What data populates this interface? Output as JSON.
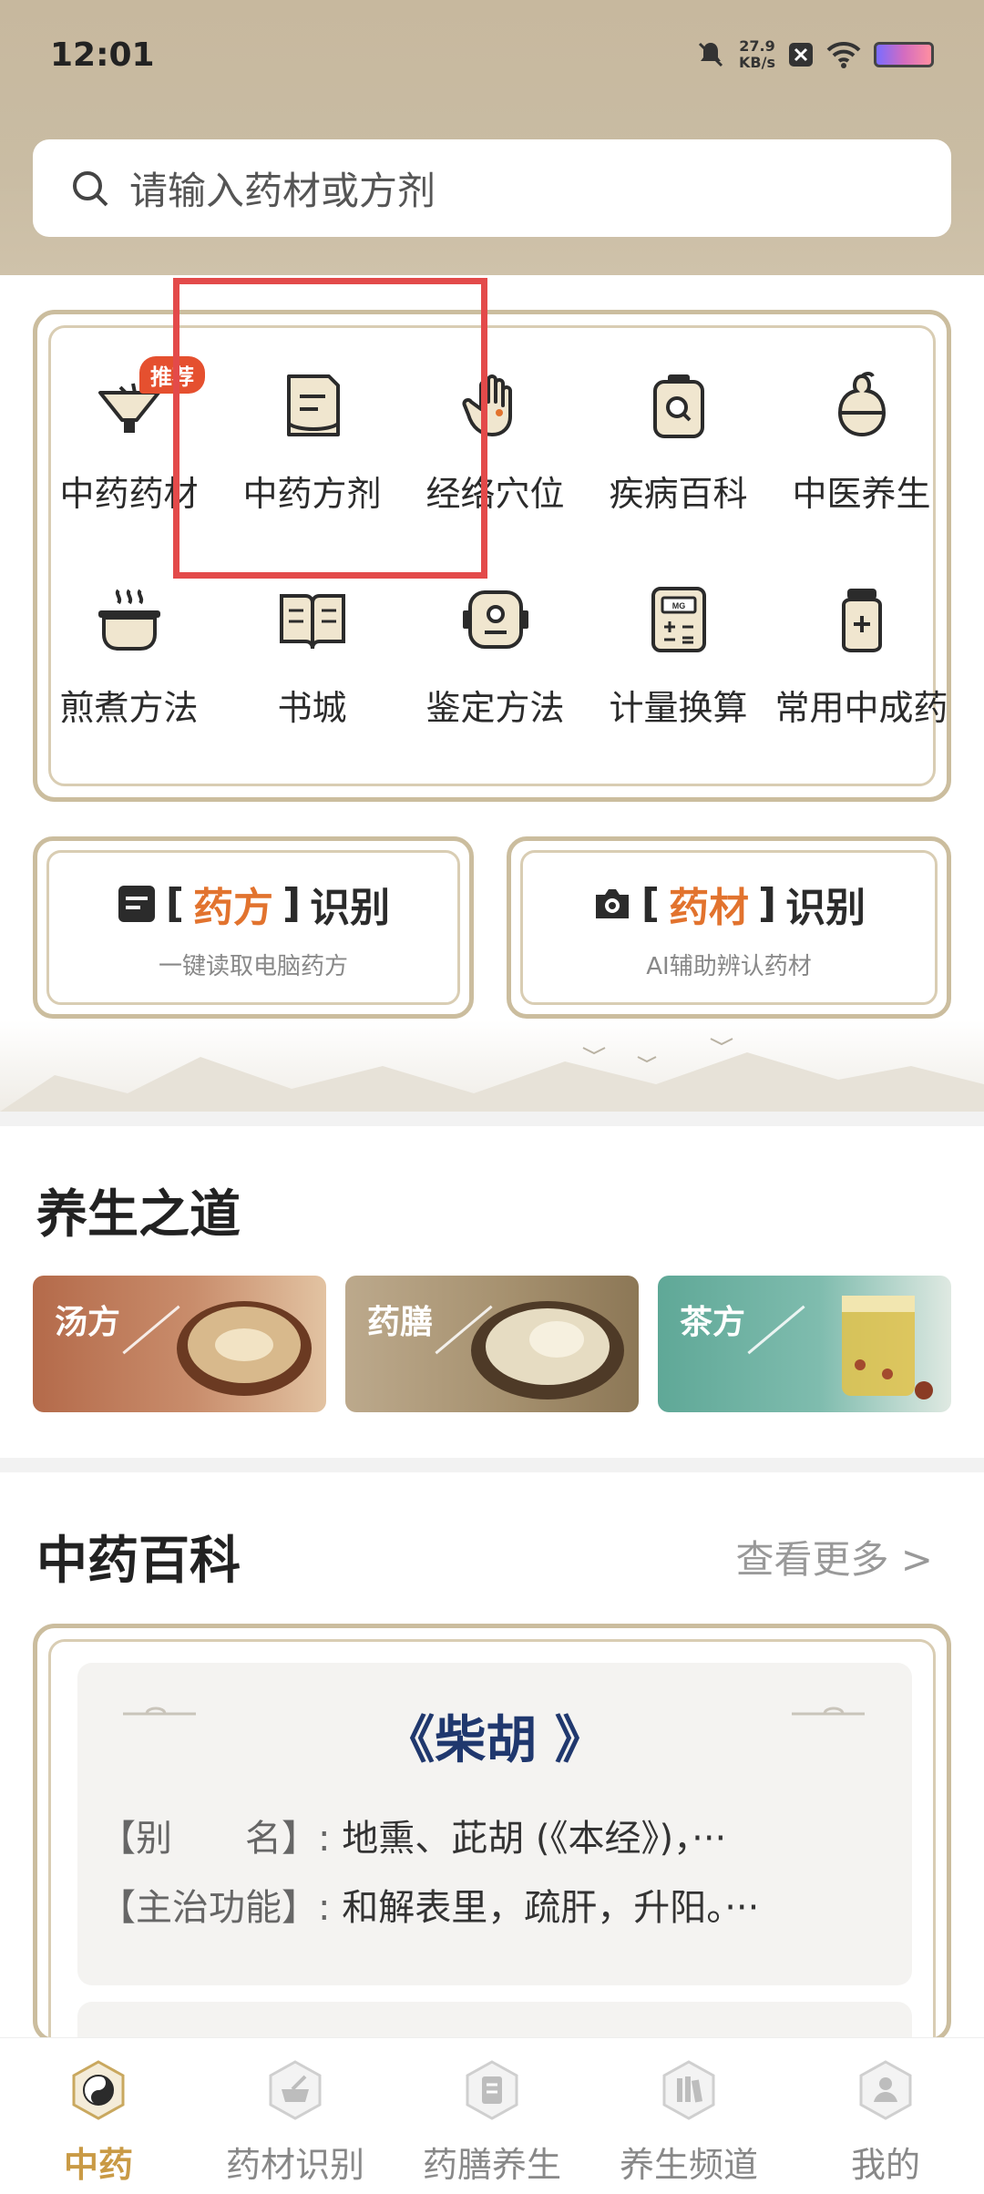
{
  "status": {
    "time": "12:01",
    "speed_value": "27.9",
    "speed_unit": "KB/s"
  },
  "search": {
    "placeholder": "请输入药材或方剂"
  },
  "grid": {
    "badge": "推荐",
    "row1": [
      {
        "label": "中药药材",
        "icon": "herb-funnel-icon"
      },
      {
        "label": "中药方剂",
        "icon": "prescription-paper-icon"
      },
      {
        "label": "经络穴位",
        "icon": "hand-acupoint-icon"
      },
      {
        "label": "疾病百科",
        "icon": "disease-search-icon"
      },
      {
        "label": "中医养生",
        "icon": "gourd-icon"
      }
    ],
    "row2": [
      {
        "label": "煎煮方法",
        "icon": "steaming-pot-icon"
      },
      {
        "label": "书城",
        "icon": "open-book-icon"
      },
      {
        "label": "鉴定方法",
        "icon": "identify-device-icon"
      },
      {
        "label": "计量换算",
        "icon": "scale-calculator-icon"
      },
      {
        "label": "常用中成药",
        "icon": "medicine-jar-icon"
      }
    ]
  },
  "recognition": {
    "prescription": {
      "bracket_open": "[",
      "accent": "药方",
      "bracket_close": "]",
      "suffix": "识别",
      "sub": "一键读取电脑药方"
    },
    "herb": {
      "bracket_open": "[",
      "accent": "药材",
      "bracket_close": "]",
      "suffix": "识别",
      "sub": "AI辅助辨认药材"
    }
  },
  "wellness": {
    "title": "养生之道",
    "tiles": [
      {
        "label": "汤方",
        "color": "#b46a4a"
      },
      {
        "label": "药膳",
        "color": "#bca98c"
      },
      {
        "label": "茶方",
        "color": "#5fa897"
      }
    ]
  },
  "encyclopedia": {
    "title": "中药百科",
    "see_more": "查看更多 >",
    "herb_name": "《柴胡 》",
    "alias_key": "【别　　名】:",
    "alias_value": " 地熏、茈胡 (《本经》)，···",
    "function_key": "【主治功能】:",
    "function_value": " 和解表里，疏肝，升阳。···"
  },
  "nav": [
    {
      "label": "中药",
      "icon": "taiji-icon",
      "active": true
    },
    {
      "label": "药材识别",
      "icon": "mortar-icon",
      "active": false
    },
    {
      "label": "药膳养生",
      "icon": "recipe-book-icon",
      "active": false
    },
    {
      "label": "养生频道",
      "icon": "bookshelf-icon",
      "active": false
    },
    {
      "label": "我的",
      "icon": "profile-icon",
      "active": false
    }
  ],
  "colors": {
    "accent": "#e2732e",
    "highlight": "#e34a4a",
    "nav_active": "#c99a45",
    "herb_name": "#20386e"
  }
}
